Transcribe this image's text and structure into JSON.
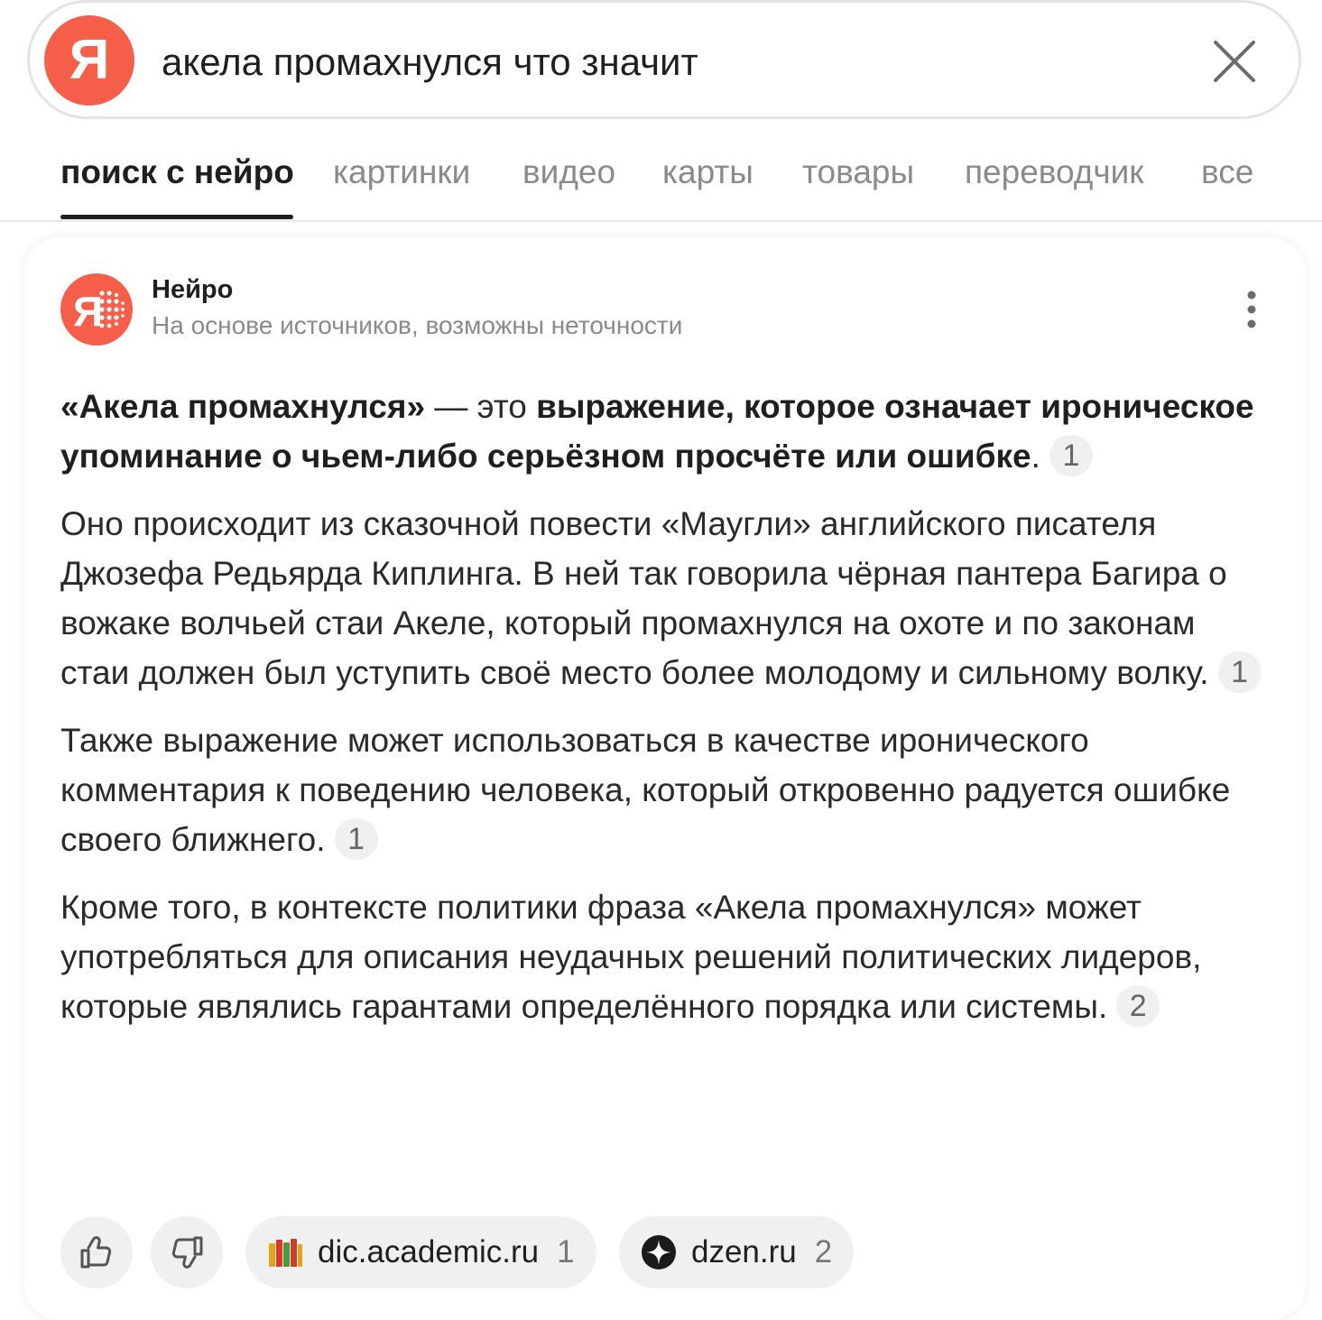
{
  "search": {
    "logo_letter": "Я",
    "query": "акела промахнулся что значит",
    "clear_icon": "close-icon"
  },
  "tabs": [
    {
      "label": "поиск с нейро",
      "active": true
    },
    {
      "label": "картинки"
    },
    {
      "label": "видео"
    },
    {
      "label": "карты"
    },
    {
      "label": "товары"
    },
    {
      "label": "переводчик"
    },
    {
      "label": "все"
    }
  ],
  "neuro": {
    "title": "Нейро",
    "subtitle": "На основе источников, возможны неточности",
    "icon": "neuro-logo-icon",
    "menu_icon": "more-vertical-icon"
  },
  "answer": {
    "p1": {
      "term": "«Акела промахнулся»",
      "dash": " — это ",
      "bold_def": "выражение, которое означает ироническое упоминание о чьем-либо серьёзном просчёте или ошибке",
      "end": ".",
      "ref": "1"
    },
    "p2": {
      "text": "Оно происходит из сказочной повести «Маугли» английского писателя Джозефа Редьярда Киплинга. В ней так говорила чёрная пантера Багира о вожаке волчьей стаи Акеле, который промахнулся на охоте и по законам стаи должен был уступить своё место более молодому и сильному волку.",
      "ref": "1"
    },
    "p3": {
      "text": "Также выражение может использоваться в качестве иронического комментария к поведению человека, который откровенно радуется ошибке своего ближнего.",
      "ref": "1"
    },
    "p4": {
      "text": "Кроме того, в контексте политики фраза «Акела промахнулся» может употребляться для описания неудачных решений политических лидеров, которые являлись гарантами определённого порядка или системы.",
      "ref": "2"
    }
  },
  "feedback": {
    "like_icon": "thumbs-up-icon",
    "dislike_icon": "thumbs-down-icon"
  },
  "sources": [
    {
      "name": "dic.academic.ru",
      "num": "1",
      "icon": "books-icon"
    },
    {
      "name": "dzen.ru",
      "num": "2",
      "icon": "dzen-star-icon"
    }
  ],
  "colors": {
    "brand": "#f55f4a",
    "muted": "#8a8a8a",
    "chip_bg": "#f0f0f0"
  }
}
